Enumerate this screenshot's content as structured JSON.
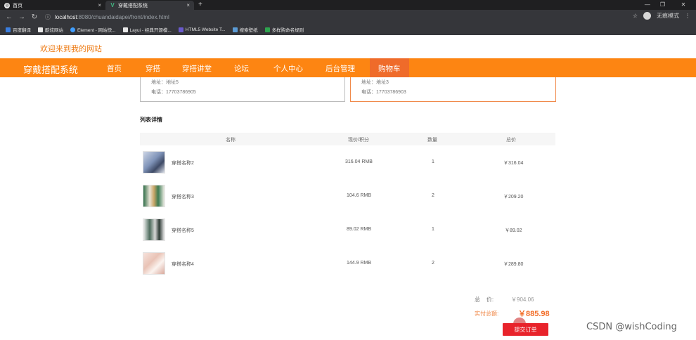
{
  "browser": {
    "tabs": [
      {
        "title": "首页"
      },
      {
        "title": "穿戴搭配系统"
      }
    ],
    "url_host": "localhost",
    "url_path": ":8080/chuandaidapei/front/index.html",
    "incognito_label": "无痕模式",
    "bookmarks": [
      {
        "label": "百度翻译",
        "color": "#3a7ee0"
      },
      {
        "label": "酷炫网站",
        "color": "#e8e8e8"
      },
      {
        "label": "Element - 网站快...",
        "color": "#409eff"
      },
      {
        "label": "Layui - 经典开源模...",
        "color": "#e8e8e8"
      },
      {
        "label": "HTML5 Website T...",
        "color": "#6a5acd"
      },
      {
        "label": "搜索壁纸",
        "color": "#5b9bd5"
      },
      {
        "label": "多样购命名规则",
        "color": "#2ea44f"
      }
    ]
  },
  "header": {
    "welcome": "欢迎来到我的网站",
    "brand": "穿戴搭配系统",
    "nav": [
      "首页",
      "穿搭",
      "穿搭讲堂",
      "论坛",
      "个人中心",
      "后台管理",
      "购物车"
    ],
    "active_color": "#ef6b2a",
    "bar_color": "#fd8512"
  },
  "addresses": [
    {
      "address": "地址：地址5",
      "phone": "电话：17703786905"
    },
    {
      "address": "地址：地址3",
      "phone": "电话：17703786903"
    }
  ],
  "list": {
    "title": "列表详情",
    "columns": [
      "名称",
      "现价/积分",
      "数量",
      "总价"
    ],
    "rows": [
      {
        "name": "穿搭名称2",
        "price": "316.04 RMB",
        "qty": "1",
        "total": "￥316.04",
        "thumb": "#9aa9c4"
      },
      {
        "name": "穿搭名称3",
        "price": "104.6 RMB",
        "qty": "2",
        "total": "￥209.20",
        "thumb": "#4f8a62"
      },
      {
        "name": "穿搭名称5",
        "price": "89.02 RMB",
        "qty": "1",
        "total": "￥89.02",
        "thumb": "#5c7a6b"
      },
      {
        "name": "穿搭名称4",
        "price": "144.9 RMB",
        "qty": "2",
        "total": "￥289.80",
        "thumb": "#e8c8c0"
      }
    ]
  },
  "summary": {
    "total_label": "总    价:",
    "total_value": "￥904.06",
    "paid_label": "实付总额:",
    "paid_value": "￥885.98",
    "submit": "提交订单"
  },
  "watermark": "CSDN @wishCoding"
}
